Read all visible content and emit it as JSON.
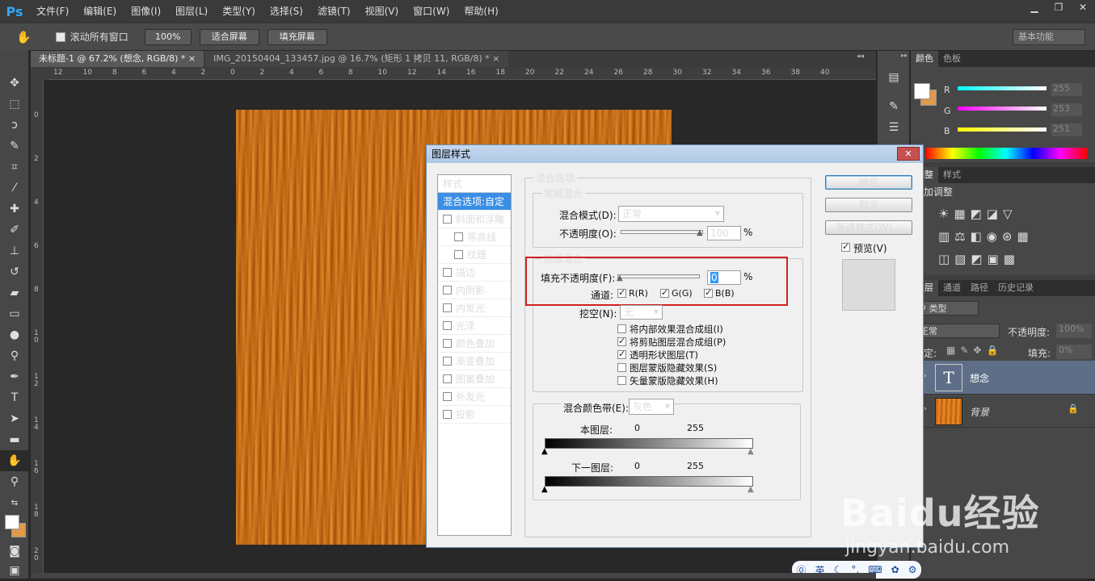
{
  "app": {
    "logo": "Ps"
  },
  "menu": [
    "文件(F)",
    "编辑(E)",
    "图像(I)",
    "图层(L)",
    "类型(Y)",
    "选择(S)",
    "滤镜(T)",
    "视图(V)",
    "窗口(W)",
    "帮助(H)"
  ],
  "options": {
    "scroll_all": "滚动所有窗口",
    "zoom": "100%",
    "fit": "适合屏幕",
    "fill": "填充屏幕",
    "workspace": "基本功能"
  },
  "tabs": [
    "未标题-1 @ 67.2% (想念, RGB/8) *",
    "IMG_20150404_133457.jpg @ 16.7% (矩形 1 拷贝 11, RGB/8) *"
  ],
  "ruler": {
    "h": [
      "12",
      "10",
      "8",
      "6",
      "4",
      "2",
      "0",
      "2",
      "4",
      "6",
      "8",
      "10",
      "12",
      "14",
      "16",
      "18",
      "20",
      "22",
      "24",
      "26",
      "28",
      "30",
      "32",
      "34",
      "36",
      "38",
      "40"
    ],
    "v": [
      "0",
      "2",
      "4",
      "6",
      "8",
      "1 0",
      "1 2",
      "1 4",
      "1 6",
      "1 8",
      "2 0"
    ]
  },
  "color_panel": {
    "tabs": [
      "颜色",
      "色板"
    ],
    "r": "R",
    "g": "G",
    "b": "B",
    "r_val": "255",
    "g_val": "253",
    "b_val": "251"
  },
  "adjust_panel": {
    "tabs": [
      "调整",
      "样式"
    ],
    "title": "添加调整"
  },
  "layers_panel": {
    "tabs": [
      "图层",
      "通道",
      "路径",
      "历史记录"
    ],
    "kind": "类型",
    "blend": "正常",
    "opacity_label": "不透明度:",
    "opacity": "100%",
    "lock_label": "锁定:",
    "fill_label": "填充:",
    "fill": "0%",
    "layers": [
      {
        "name": "想念",
        "thumb": "T"
      },
      {
        "name": "背景"
      }
    ]
  },
  "dialog": {
    "title": "图层样式",
    "styles_header": "样式",
    "styles": [
      {
        "label": "混合选项:自定",
        "check": false,
        "active": true,
        "indent": false
      },
      {
        "label": "斜面和浮雕",
        "check": true,
        "indent": false
      },
      {
        "label": "等高线",
        "check": true,
        "indent": true
      },
      {
        "label": "纹理",
        "check": true,
        "indent": true
      },
      {
        "label": "描边",
        "check": true,
        "indent": false
      },
      {
        "label": "内阴影",
        "check": true,
        "indent": false
      },
      {
        "label": "内发光",
        "check": true,
        "indent": false
      },
      {
        "label": "光泽",
        "check": true,
        "indent": false
      },
      {
        "label": "颜色叠加",
        "check": true,
        "indent": false
      },
      {
        "label": "渐变叠加",
        "check": true,
        "indent": false
      },
      {
        "label": "图案叠加",
        "check": true,
        "indent": false
      },
      {
        "label": "外发光",
        "check": true,
        "indent": false
      },
      {
        "label": "投影",
        "check": true,
        "indent": false
      }
    ],
    "blend_options": "混合选项",
    "general_blend": "常规混合",
    "blend_mode_label": "混合模式(D):",
    "blend_mode": "正常",
    "opacity_label": "不透明度(O):",
    "opacity": "100",
    "pct": "%",
    "advanced_blend": "高级混合",
    "fill_opacity_label": "填充不透明度(F):",
    "fill_opacity": "0",
    "channels_label": "通道:",
    "ch_r": "R(R)",
    "ch_g": "G(G)",
    "ch_b": "B(B)",
    "knockout_label": "挖空(N):",
    "knockout": "无",
    "opts": [
      "将内部效果混合成组(I)",
      "将剪贴图层混合成组(P)",
      "透明形状图层(T)",
      "图层蒙版隐藏效果(S)",
      "矢量蒙版隐藏效果(H)"
    ],
    "opts_checked": [
      false,
      true,
      true,
      false,
      false
    ],
    "blend_if_label": "混合颜色带(E):",
    "blend_if": "灰色",
    "this_layer": "本图层:",
    "underlying": "下一图层:",
    "v0": "0",
    "v255": "255",
    "ok": "确定",
    "cancel": "取消",
    "new_style": "新建样式(W)...",
    "preview": "预览(V)"
  },
  "watermark": {
    "brand": "Baidu经验",
    "url": "jingyan.baidu.com"
  },
  "ime": {
    "label": "英"
  }
}
